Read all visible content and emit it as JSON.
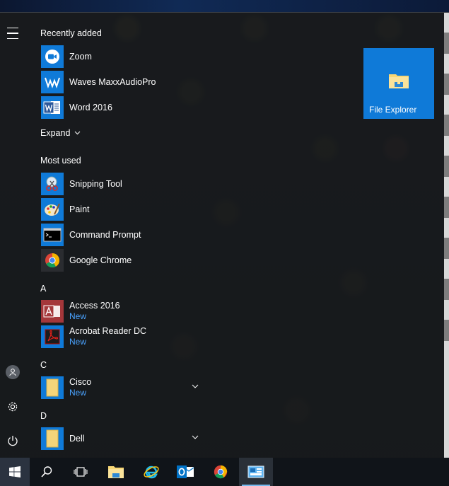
{
  "start_menu": {
    "sections": {
      "recently_added": "Recently added",
      "expand": "Expand",
      "most_used": "Most used",
      "letter_a": "A",
      "letter_c": "C",
      "letter_d": "D"
    },
    "recent_apps": [
      {
        "name": "Zoom",
        "icon": "zoom-icon"
      },
      {
        "name": "Waves MaxxAudioPro",
        "icon": "waves-icon"
      },
      {
        "name": "Word 2016",
        "icon": "word-icon"
      }
    ],
    "most_used_apps": [
      {
        "name": "Snipping Tool",
        "icon": "snipping-tool-icon"
      },
      {
        "name": "Paint",
        "icon": "paint-icon"
      },
      {
        "name": "Command Prompt",
        "icon": "command-prompt-icon"
      },
      {
        "name": "Google Chrome",
        "icon": "chrome-icon"
      }
    ],
    "a_apps": [
      {
        "name": "Access 2016",
        "badge": "New",
        "icon": "access-icon"
      },
      {
        "name": "Acrobat Reader DC",
        "badge": "New",
        "icon": "acrobat-icon"
      }
    ],
    "c_apps": [
      {
        "name": "Cisco",
        "badge": "New",
        "icon": "folder-icon"
      }
    ],
    "d_apps": [
      {
        "name": "Dell",
        "icon": "folder-icon"
      }
    ],
    "tiles": [
      {
        "name": "File Explorer",
        "icon": "file-explorer-icon",
        "color": "#0f7ad8"
      }
    ]
  },
  "taskbar": {
    "items": [
      "windows-start-icon",
      "search-icon",
      "task-view-icon",
      "file-explorer-icon",
      "internet-explorer-icon",
      "outlook-icon",
      "chrome-icon",
      "control-panel-icon"
    ],
    "active_item": "control-panel-icon"
  },
  "colors": {
    "accent": "#0f7ad8",
    "new_badge": "#4aa3ff",
    "menu_background": "#17191c"
  }
}
